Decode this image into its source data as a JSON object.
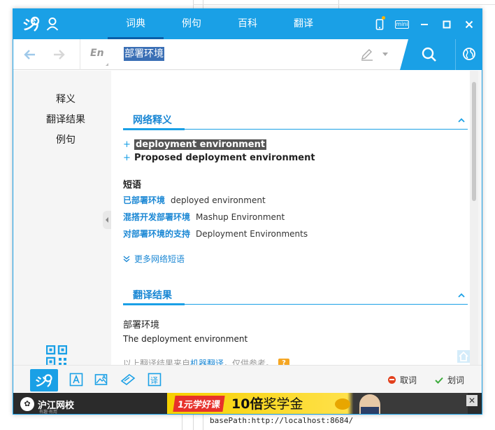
{
  "app": {
    "tabs": [
      {
        "label": "词典",
        "active": true
      },
      {
        "label": "例句",
        "active": false
      },
      {
        "label": "百科",
        "active": false
      },
      {
        "label": "翻译",
        "active": false
      }
    ],
    "mini_label": "mini",
    "accent_color": "#1aa0e6"
  },
  "search": {
    "lang_label": "En",
    "query": "部署环境"
  },
  "left_nav": {
    "items": [
      "释义",
      "翻译结果",
      "例句"
    ]
  },
  "web_definitions": {
    "title": "网络释义",
    "entries": [
      "deployment environment",
      "Proposed deployment environment"
    ],
    "phrases_title": "短语",
    "phrases": [
      {
        "zh": "已部署环境",
        "en": "deployed environment"
      },
      {
        "zh": "混搭开发部署环境",
        "en": "Mashup Environment"
      },
      {
        "zh": "对部署环境的支持",
        "en": "Deployment Environments"
      }
    ],
    "more_label": "更多网络短语"
  },
  "translation": {
    "title": "翻译结果",
    "source": "部署环境",
    "result": "The deployment environment",
    "note_prefix": "以上翻译结果来自",
    "note_link": "机器翻译",
    "note_suffix": "，仅供参考。",
    "badge": "?"
  },
  "toolbar": {
    "capture_label": "取词",
    "select_label": "划词"
  },
  "ad": {
    "brand": "沪江网校",
    "slogan": "有趣·有用",
    "tag": "1元学好课",
    "headline_big": "10倍",
    "headline_rest": "奖学金",
    "close": "✕"
  },
  "background": {
    "code_line": "basePath:http://localhost:8684/"
  }
}
